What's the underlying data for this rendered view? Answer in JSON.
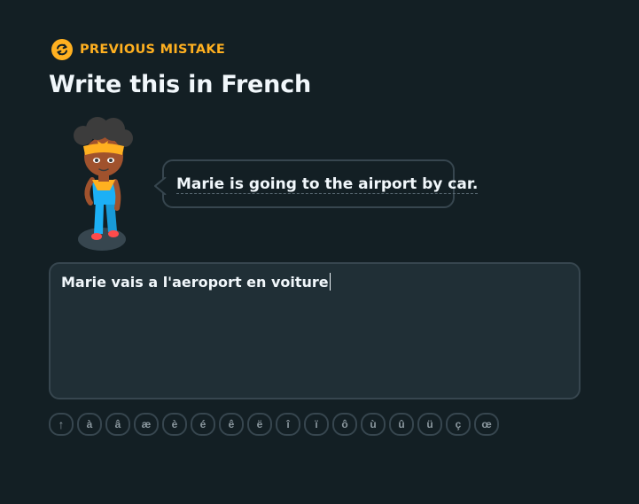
{
  "theme": {
    "background": "#131f24",
    "accent": "#ffb020",
    "border": "#37464f",
    "text": "#f1f7fb"
  },
  "header": {
    "badge_label": "PREVIOUS MISTAKE",
    "badge_icon": "repeat-icon"
  },
  "exercise": {
    "title": "Write this in French",
    "prompt": "Marie is going to the airport by car."
  },
  "answer": {
    "value": "Marie vais a l'aeroport en voiture"
  },
  "keyboard": {
    "shift_icon": "arrow-up-icon",
    "shift_label": "↑",
    "keys": [
      "à",
      "â",
      "æ",
      "è",
      "é",
      "ê",
      "ë",
      "î",
      "ï",
      "ô",
      "ù",
      "û",
      "ü",
      "ç",
      "œ"
    ]
  }
}
